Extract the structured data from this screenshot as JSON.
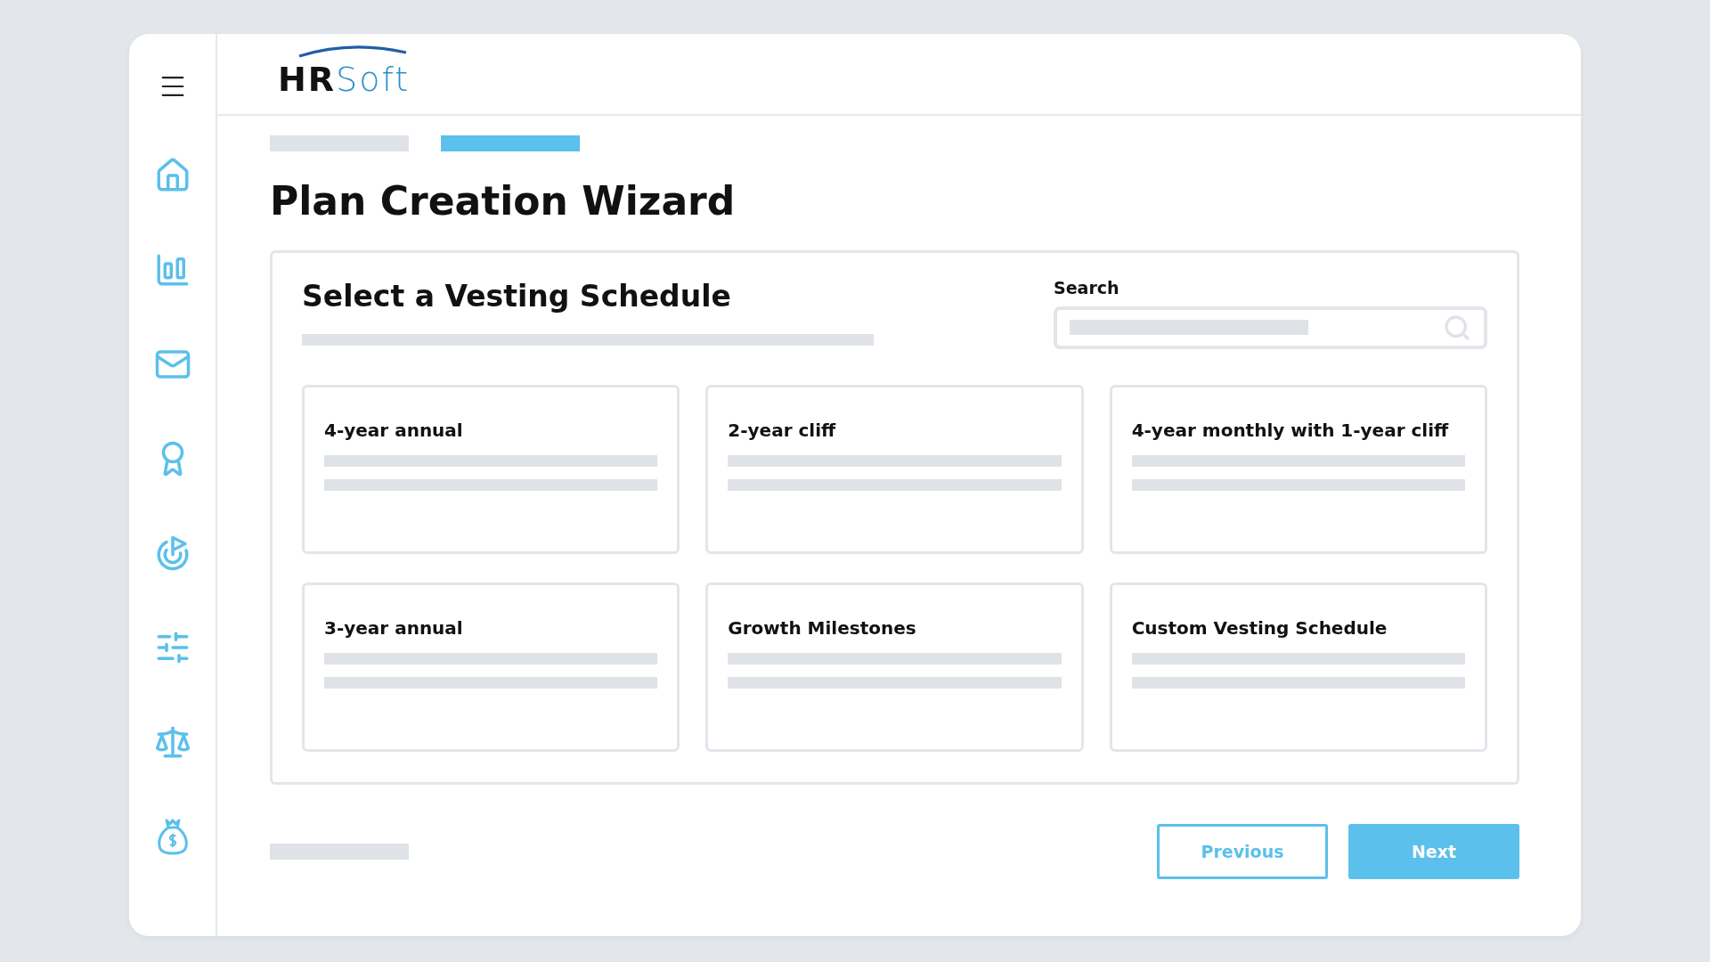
{
  "logo": {
    "bold": "HR",
    "light": "Soft"
  },
  "progress_steps": [
    {
      "selected": false
    },
    {
      "selected": true
    }
  ],
  "title": "Plan Creation Wizard",
  "panel": {
    "title": "Select a Vesting Schedule",
    "search": {
      "label": "Search"
    },
    "options": [
      {
        "label": "4-year annual"
      },
      {
        "label": "2-year cliff"
      },
      {
        "label": "4-year monthly with 1-year cliff"
      },
      {
        "label": "3-year annual"
      },
      {
        "label": "Growth Milestones"
      },
      {
        "label": "Custom Vesting Schedule"
      }
    ]
  },
  "buttons": [
    {
      "label": "Previous",
      "kind": "secondary"
    },
    {
      "label": "Next",
      "kind": "primary"
    }
  ]
}
